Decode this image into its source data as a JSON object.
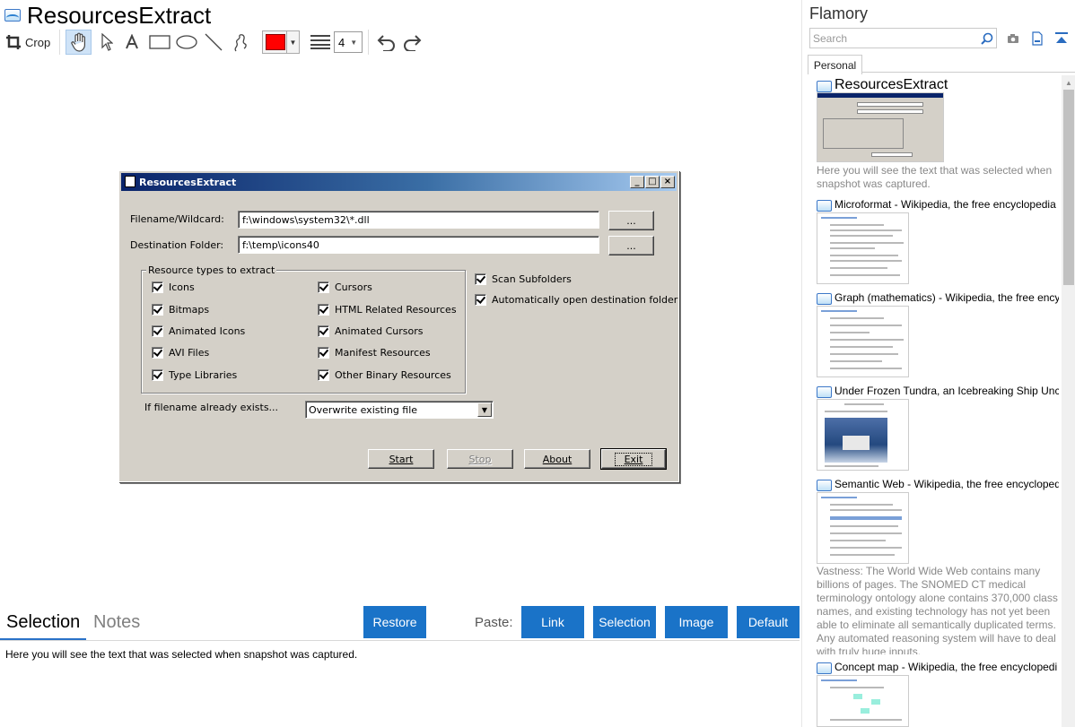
{
  "header": {
    "title": "ResourcesExtract",
    "toolbar": {
      "crop_label": "Crop",
      "line_width": "4",
      "draw_color": "#ff0000"
    }
  },
  "screenshot_window": {
    "title": "ResourcesExtract",
    "filename_label": "Filename/Wildcard:",
    "filename_value": "f:\\windows\\system32\\*.dll",
    "destination_label": "Destination Folder:",
    "destination_value": "f:\\temp\\icons40",
    "browse_label": "...",
    "group_title": "Resource types to extract",
    "resource_types": [
      {
        "label": "Icons",
        "checked": true
      },
      {
        "label": "Bitmaps",
        "checked": true
      },
      {
        "label": "Animated Icons",
        "checked": true
      },
      {
        "label": "AVI Files",
        "checked": true
      },
      {
        "label": "Type Libraries",
        "checked": true
      },
      {
        "label": "Cursors",
        "checked": true
      },
      {
        "label": "HTML Related Resources",
        "checked": true
      },
      {
        "label": "Animated Cursors",
        "checked": true
      },
      {
        "label": "Manifest Resources",
        "checked": true
      },
      {
        "label": "Other Binary Resources",
        "checked": true
      }
    ],
    "options": [
      {
        "label": "Scan Subfolders",
        "checked": true
      },
      {
        "label": "Automatically open destination folder",
        "checked": true
      }
    ],
    "exists_label": "If filename already exists...",
    "exists_value": "Overwrite existing file",
    "buttons": {
      "start": "Start",
      "stop": "Stop",
      "about": "About",
      "exit": "Exit"
    }
  },
  "bottom": {
    "tabs": [
      "Selection",
      "Notes"
    ],
    "restore": "Restore",
    "paste_label": "Paste:",
    "paste_buttons": [
      "Link",
      "Selection",
      "Image",
      "Default"
    ],
    "selection_text": "Here you will see the text that was selected when snapshot was captured."
  },
  "sidebar": {
    "title": "Flamory",
    "search_placeholder": "Search",
    "tab": "Personal",
    "snapshots": [
      {
        "title": "ResourcesExtract",
        "description": "Here you will see the text that was selected when snapshot was captured."
      },
      {
        "title": "Microformat - Wikipedia, the free encyclopedia"
      },
      {
        "title": "Graph (mathematics) - Wikipedia, the free ency"
      },
      {
        "title": "Under Frozen Tundra, an Icebreaking Ship Unco"
      },
      {
        "title": "Semantic Web - Wikipedia, the free encycloped",
        "description": "Vastness: The World Wide Web contains many billions of pages. The SNOMED CT medical terminology ontology alone contains 370,000 class names, and existing technology has not yet been able to eliminate all semantically duplicated terms. Any automated reasoning system will have to deal with truly huge inputs."
      },
      {
        "title": "Concept map - Wikipedia, the free encyclopedi"
      }
    ]
  },
  "colors": {
    "accent": "#1a73c8"
  }
}
